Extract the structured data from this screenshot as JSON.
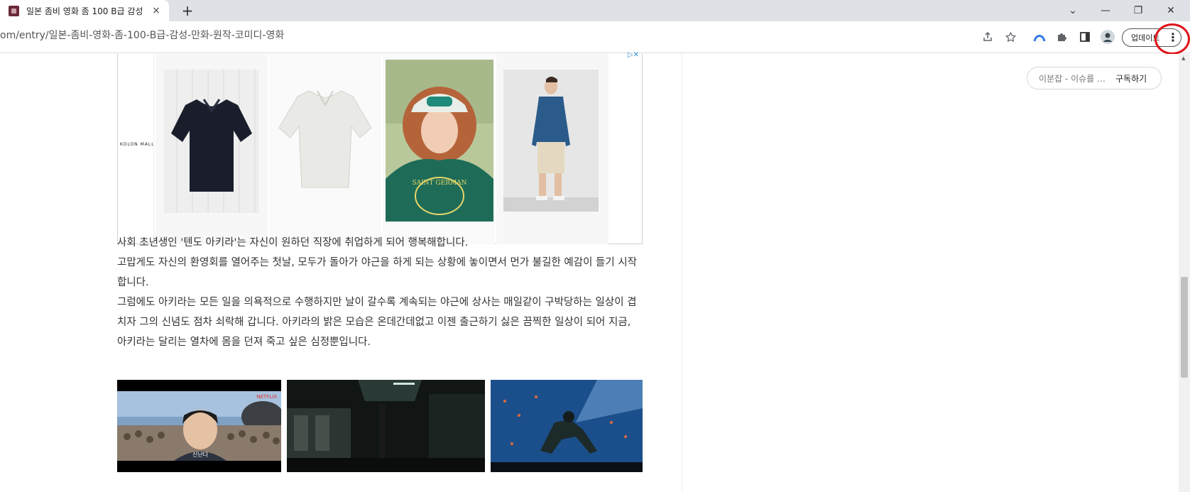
{
  "browser": {
    "tab_title": "일본 좀비 영화 좀 100 B급 감성",
    "new_tab": "+",
    "url": "om/entry/일본-좀비-영화-좀-100-B급-감성-만화-원작-코미디-영화",
    "update_label": "업데이트",
    "close_tab": "×",
    "win_min": "—",
    "win_restore": "❐",
    "win_close": "✕",
    "win_chevron": "⌄"
  },
  "sidebar": {
    "blog_name": "이분잡 - 이슈를 …",
    "subscribe_label": "구독하기"
  },
  "ad": {
    "brand": "KOLON MALL",
    "shirt_print": "SAINT GERMAN"
  },
  "article": {
    "paragraphs": [
      "사회 초년생인 '텐도 아키라'는 자신이 원하던 직장에 취업하게 되어 행복해합니다.",
      "고맙게도 자신의 환영회를 열어주는 첫날, 모두가 돌아가 야근을 하게 되는 상황에 놓이면서 먼가 불길한 예감이 들기 시작",
      "합니다.",
      "그럼에도 아키라는 모든 일을 의욕적으로 수행하지만 날이 갈수록 계속되는 야근에 상사는 매일같이 구박당하는 일상이 겹",
      "치자 그의 신념도 점차 쇠락해 갑니다. 아키라의 밝은 모습은 온데간데없고 이젠 출근하기 싫은 끔찍한 일상이 되어 지금,",
      "아키라는 달리는 열차에 몸을 던져 죽고 싶은 심정뿐입니다."
    ],
    "still1_watermark": "NETFLIX",
    "still1_subtitle": "신난다"
  },
  "colors": {
    "highlight_circle": "#e0141c",
    "favicon": "#6b2a3a"
  }
}
